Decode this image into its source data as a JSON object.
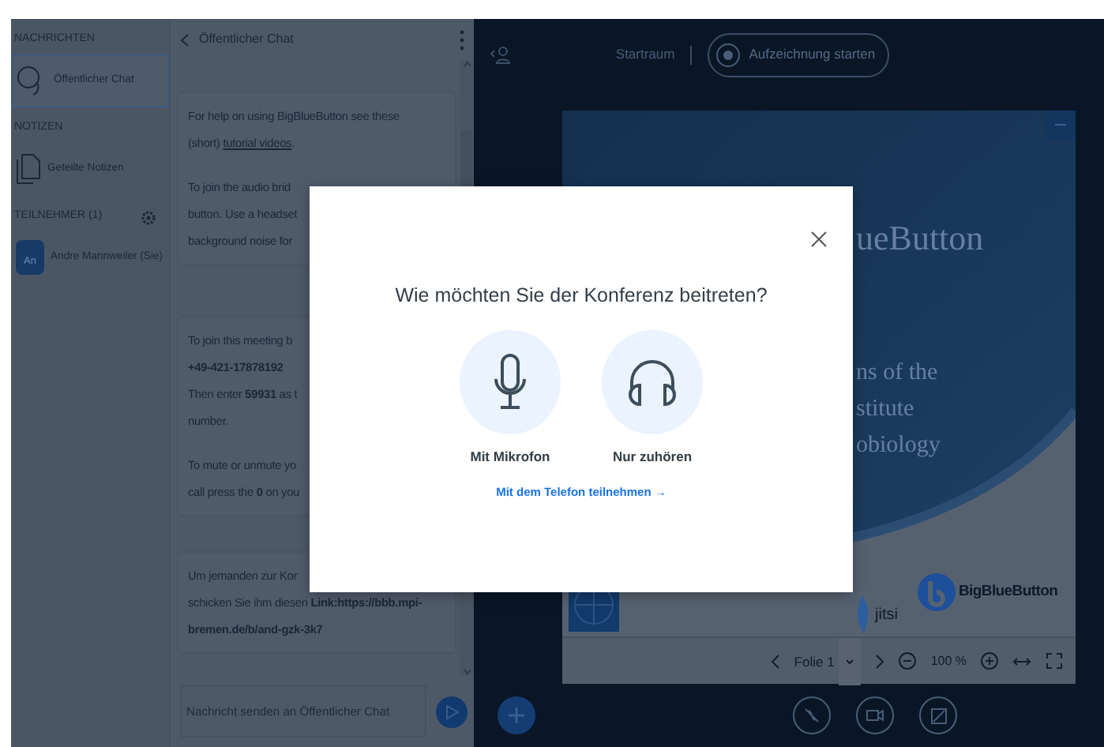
{
  "sidebar": {
    "sections": [
      {
        "heading": "NACHRICHTEN",
        "settings": false,
        "items": [
          {
            "kind": "chat",
            "label": "Öffentlicher Chat",
            "selected": true
          }
        ]
      },
      {
        "heading": "NOTIZEN",
        "settings": false,
        "items": [
          {
            "kind": "notes",
            "label": "Geteilte Notizen",
            "selected": false
          }
        ]
      },
      {
        "heading": "TEILNEHMER (1)",
        "settings": true,
        "items": [
          {
            "kind": "user",
            "avatar": "An",
            "label": "Andre Mannweiler (Sie)",
            "selected": false
          }
        ]
      }
    ]
  },
  "chat": {
    "title": "Öffentlicher Chat",
    "messages": [
      {
        "paragraphs": [
          [
            "For help on using BigBlueButton see these",
            {
              "text": "(short) ",
              "link": "tutorial videos",
              "after": "."
            }
          ],
          [
            "To join the audio brid",
            "button. Use a headset",
            "background noise for"
          ]
        ]
      },
      {
        "paragraphs": [
          [
            "To join this meeting b",
            "**+49-421-17878192**",
            "Then enter **59931** as t",
            "number."
          ],
          [
            "To mute or unmute yo",
            "call press the **0** on you"
          ]
        ]
      },
      {
        "paragraphs": [
          [
            "Um jemanden zur Kor",
            "schicken Sie ihm diesen **Link:https://bbb.mpi-**",
            "**bremen.de/b/and-gzk-3k7**"
          ]
        ]
      }
    ],
    "input": {
      "placeholder": "Nachricht senden an Öffentlicher Chat"
    }
  },
  "topbar": {
    "room": "Startraum",
    "record": "Aufzeichnung starten"
  },
  "slide": {
    "title": "ueButton",
    "lines": [
      "ns of the",
      "stitute",
      "obiology"
    ],
    "logos": [
      {
        "kind": "jitsi",
        "text": "jitsi"
      },
      {
        "kind": "bbb",
        "text": "BigBlueButton"
      }
    ],
    "toolbar": {
      "page": "Folie 1",
      "zoom": "100 %"
    }
  },
  "modal": {
    "title": "Wie möchten Sie der Konferenz beitreten?",
    "options": [
      {
        "kind": "microphone",
        "label": "Mit Mikrofon"
      },
      {
        "kind": "listen",
        "label": "Nur zuhören"
      }
    ],
    "phone_link": "Mit dem Telefon teilnehmen →"
  }
}
